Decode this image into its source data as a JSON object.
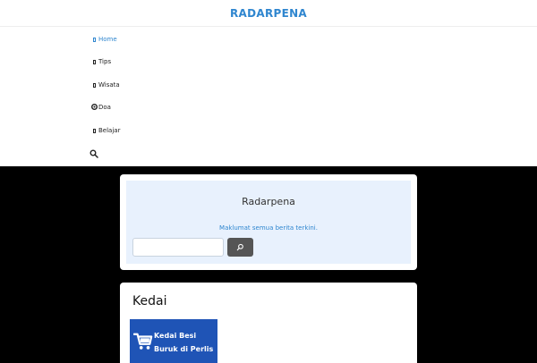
{
  "site": {
    "title": "RADARPENA"
  },
  "menu": {
    "items": [
      {
        "label": "Home",
        "icon": "home-icon",
        "active": true
      },
      {
        "label": "Tips",
        "icon": "tips-icon",
        "active": false
      },
      {
        "label": "Wisata",
        "icon": "wisata-icon",
        "active": false
      },
      {
        "label": "Doa",
        "icon": "doa-icon",
        "active": false
      },
      {
        "label": "Belajar",
        "icon": "belajar-icon",
        "active": false
      }
    ],
    "search_icon": "search-icon"
  },
  "hero": {
    "title": "Radarpena",
    "subtitle": "Maklumat semua berita terkini.",
    "search_value": "",
    "search_button_glyph": "⌕"
  },
  "widget": {
    "title": "Kedai",
    "banner": {
      "line1": "Kedai Besi",
      "line2": "Buruk di Perlis",
      "icon": "shopping-cart-icon"
    }
  },
  "colors": {
    "accent": "#2f86cf",
    "hero_bg": "#e8f1fd",
    "banner_bg": "#1f54b6",
    "button_bg": "#555555"
  }
}
